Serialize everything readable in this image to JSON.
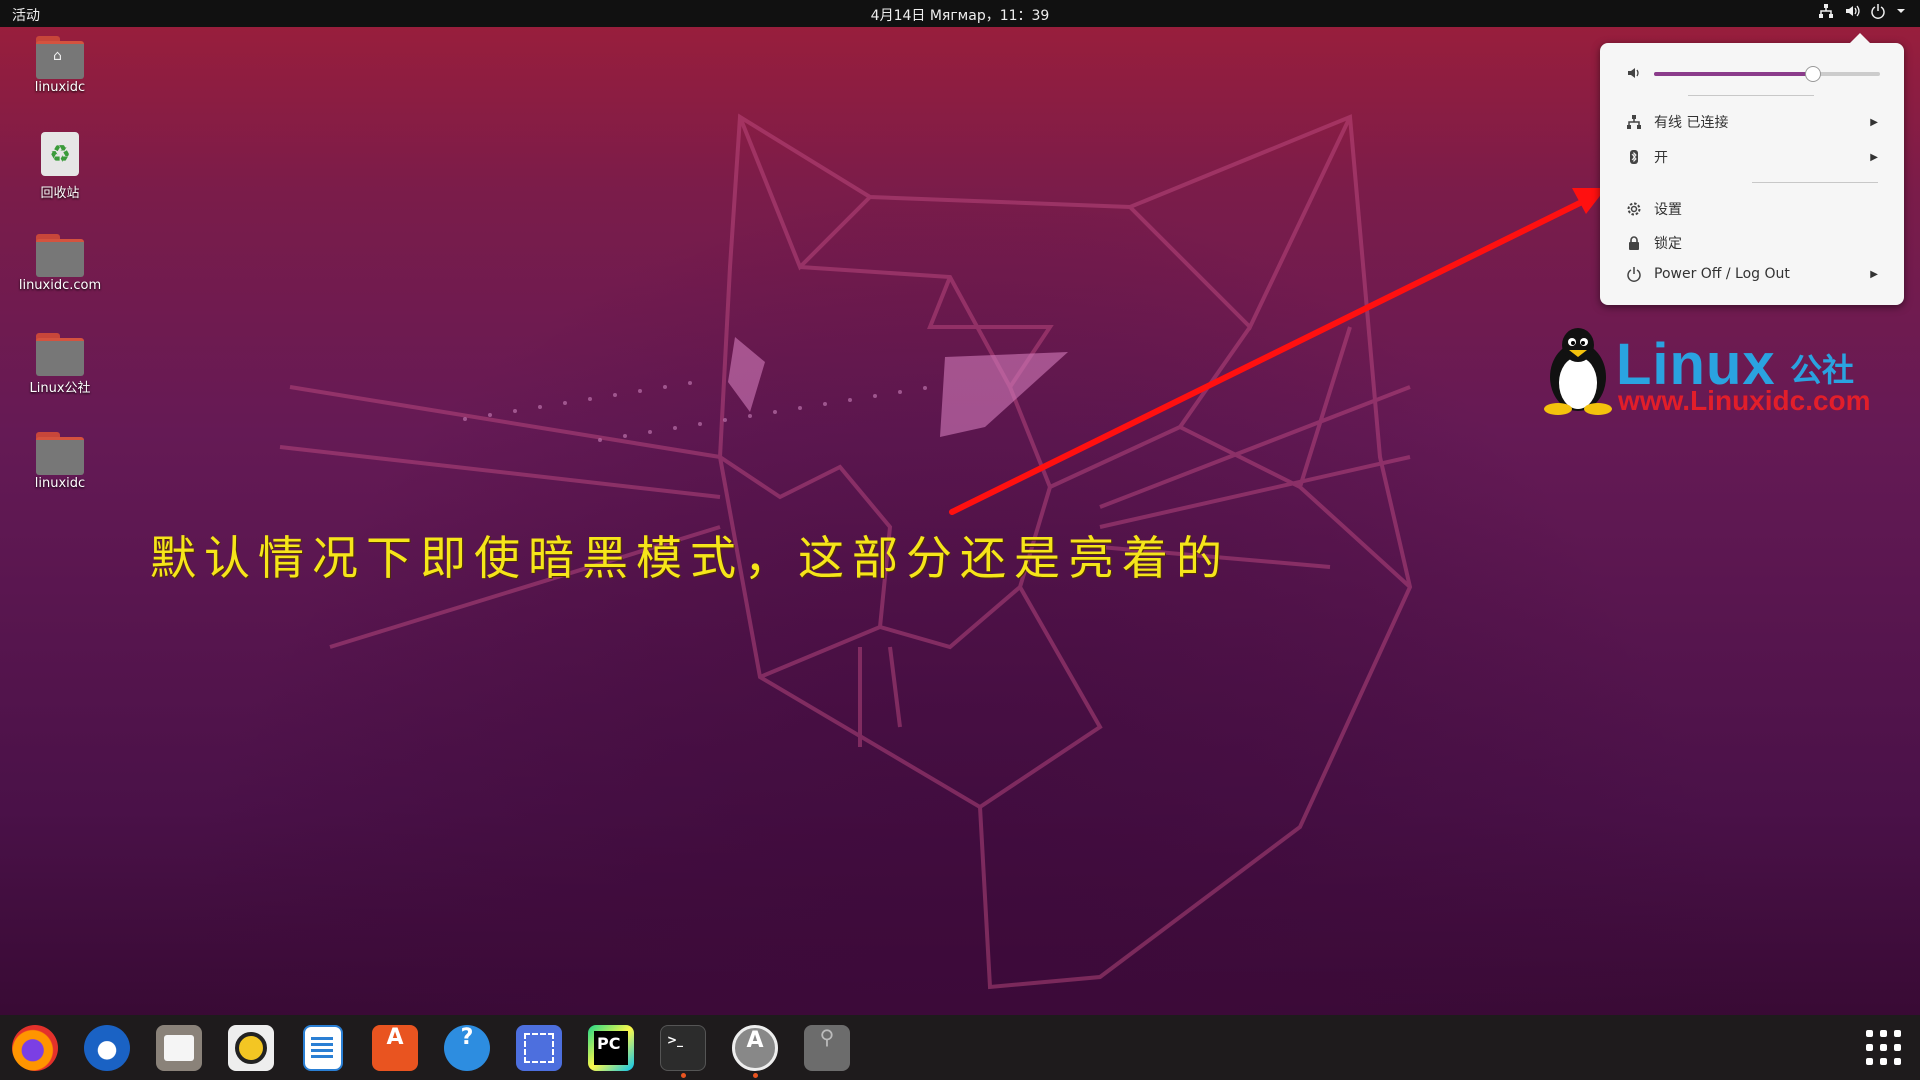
{
  "topbar": {
    "activities": "活动",
    "clock": "4月14日 Мягмар，11：39",
    "tray": [
      "network-icon",
      "volume-icon",
      "power-icon",
      "menu-chevron-icon"
    ]
  },
  "desktop": {
    "icons": [
      {
        "label": "linuxidc",
        "icon": "home-folder-icon"
      },
      {
        "label": "回收站",
        "icon": "trash-icon"
      },
      {
        "label": "linuxidc.com",
        "icon": "folder-icon"
      },
      {
        "label": "Linux公社",
        "icon": "folder-icon"
      },
      {
        "label": "linuxidc",
        "icon": "folder-icon"
      }
    ]
  },
  "system_menu": {
    "volume_level": 0.7,
    "wired": "有线 已连接",
    "bluetooth": "开",
    "settings": "设置",
    "lock": "锁定",
    "power": "Power Off / Log Out"
  },
  "watermark": {
    "word": "Linux",
    "cn": "公社",
    "url": "www.Linuxidc.com"
  },
  "caption": "默认情况下即使暗黑模式，这部分还是亮着的",
  "colors": {
    "accent": "#8b3c8b",
    "caption": "#f6e51a",
    "arrow": "#ff1010",
    "dock_indicator": "#e95420"
  },
  "dock": {
    "apps": [
      {
        "name": "Firefox",
        "icon": "firefox-icon",
        "running": false
      },
      {
        "name": "Thunderbird",
        "icon": "thunderbird-icon",
        "running": false
      },
      {
        "name": "Files",
        "icon": "files-icon",
        "running": false
      },
      {
        "name": "Rhythmbox",
        "icon": "rhythmbox-icon",
        "running": false
      },
      {
        "name": "LibreOffice Writer",
        "icon": "writer-icon",
        "running": false
      },
      {
        "name": "Ubuntu Software",
        "icon": "software-icon",
        "running": false
      },
      {
        "name": "Help",
        "icon": "help-icon",
        "running": false
      },
      {
        "name": "Screenshot",
        "icon": "screenshot-icon",
        "running": false
      },
      {
        "name": "PyCharm",
        "icon": "pycharm-icon",
        "running": false
      },
      {
        "name": "Terminal",
        "icon": "terminal-icon",
        "running": true
      },
      {
        "name": "Software Updater",
        "icon": "updater-icon",
        "running": true
      },
      {
        "name": "USB",
        "icon": "usb-icon",
        "running": false
      }
    ],
    "pycharm_text": "PC",
    "terminal_text": ">_",
    "help_text": "?"
  }
}
